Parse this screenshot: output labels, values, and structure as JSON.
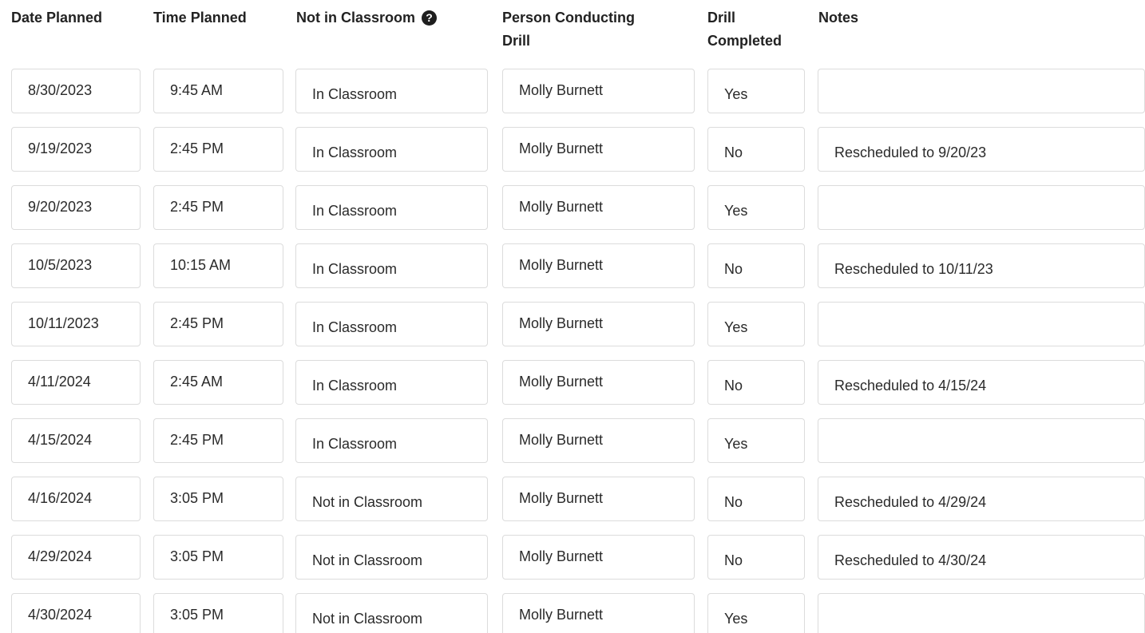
{
  "headers": {
    "date_planned": "Date Planned",
    "time_planned": "Time Planned",
    "not_in_classroom": "Not in Classroom",
    "person_line1": "Person Conducting",
    "person_line2": "Drill",
    "completed_line1": "Drill",
    "completed_line2": "Completed",
    "notes": "Notes"
  },
  "help_icon": "question-circle-icon",
  "rows": [
    {
      "date": "8/30/2023",
      "time": "9:45 AM",
      "location": "In Classroom",
      "person": "Molly Burnett",
      "completed": "Yes",
      "notes": ""
    },
    {
      "date": "9/19/2023",
      "time": "2:45 PM",
      "location": "In Classroom",
      "person": "Molly Burnett",
      "completed": "No",
      "notes": "Rescheduled to 9/20/23"
    },
    {
      "date": "9/20/2023",
      "time": "2:45 PM",
      "location": "In Classroom",
      "person": "Molly Burnett",
      "completed": "Yes",
      "notes": ""
    },
    {
      "date": "10/5/2023",
      "time": "10:15 AM",
      "location": "In Classroom",
      "person": "Molly Burnett",
      "completed": "No",
      "notes": "Rescheduled to 10/11/23"
    },
    {
      "date": "10/11/2023",
      "time": "2:45 PM",
      "location": "In Classroom",
      "person": "Molly Burnett",
      "completed": "Yes",
      "notes": ""
    },
    {
      "date": "4/11/2024",
      "time": "2:45 AM",
      "location": "In Classroom",
      "person": "Molly Burnett",
      "completed": "No",
      "notes": "Rescheduled to 4/15/24"
    },
    {
      "date": "4/15/2024",
      "time": "2:45 PM",
      "location": "In Classroom",
      "person": "Molly Burnett",
      "completed": "Yes",
      "notes": ""
    },
    {
      "date": "4/16/2024",
      "time": "3:05 PM",
      "location": "Not in Classroom",
      "person": "Molly Burnett",
      "completed": "No",
      "notes": "Rescheduled to 4/29/24"
    },
    {
      "date": "4/29/2024",
      "time": "3:05 PM",
      "location": "Not in Classroom",
      "person": "Molly Burnett",
      "completed": "No",
      "notes": "Rescheduled to 4/30/24"
    },
    {
      "date": "4/30/2024",
      "time": "3:05 PM",
      "location": "Not in Classroom",
      "person": "Molly Burnett",
      "completed": "Yes",
      "notes": ""
    }
  ]
}
